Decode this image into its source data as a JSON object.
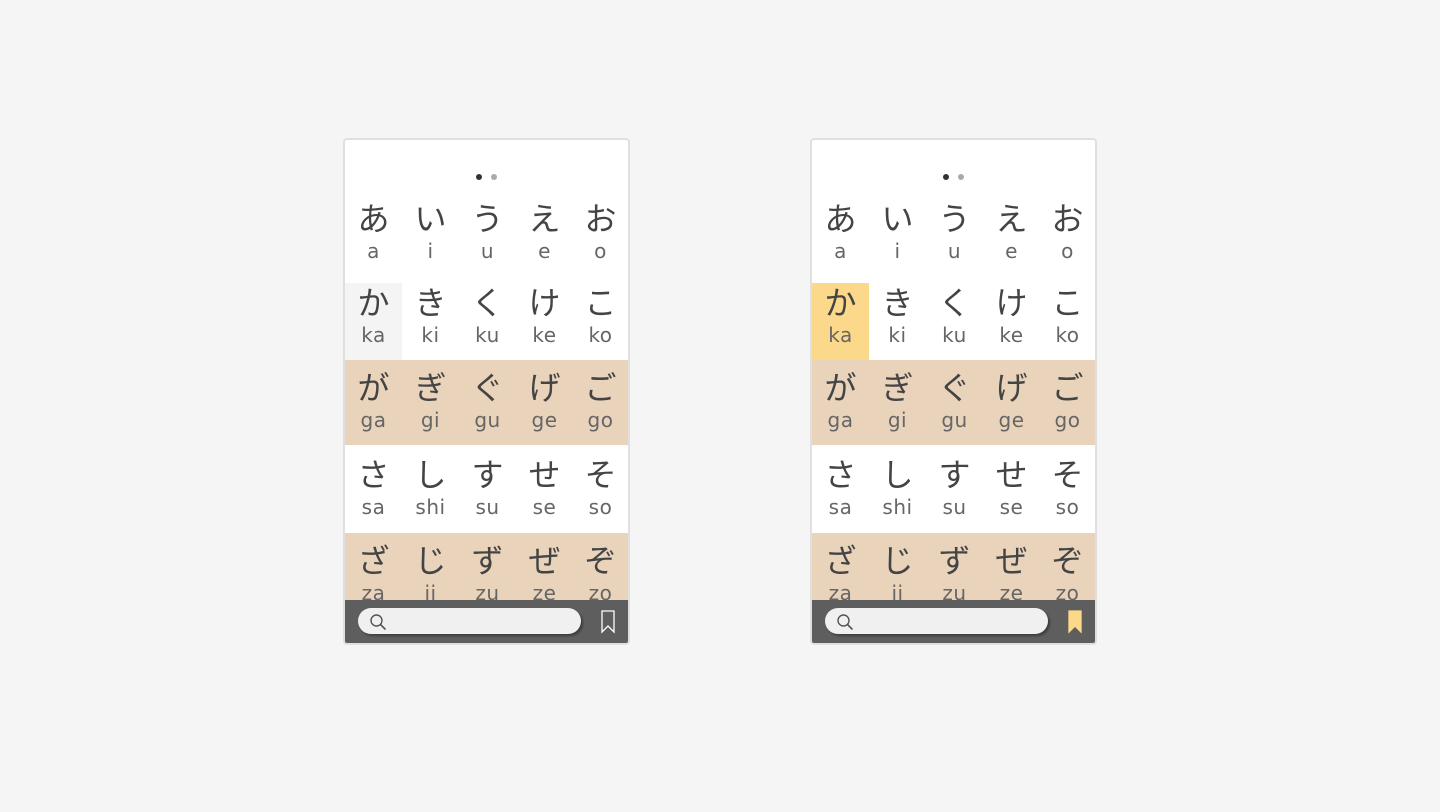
{
  "pager": {
    "pages": 2,
    "current": 1
  },
  "rows": [
    {
      "type": "plain",
      "cells": [
        {
          "kana": "あ",
          "romaji": "a"
        },
        {
          "kana": "い",
          "romaji": "i"
        },
        {
          "kana": "う",
          "romaji": "u"
        },
        {
          "kana": "え",
          "romaji": "e"
        },
        {
          "kana": "お",
          "romaji": "o"
        }
      ]
    },
    {
      "type": "plain",
      "cells": [
        {
          "kana": "か",
          "romaji": "ka"
        },
        {
          "kana": "き",
          "romaji": "ki"
        },
        {
          "kana": "く",
          "romaji": "ku"
        },
        {
          "kana": "け",
          "romaji": "ke"
        },
        {
          "kana": "こ",
          "romaji": "ko"
        }
      ]
    },
    {
      "type": "dakuten",
      "cells": [
        {
          "kana": "が",
          "romaji": "ga"
        },
        {
          "kana": "ぎ",
          "romaji": "gi"
        },
        {
          "kana": "ぐ",
          "romaji": "gu"
        },
        {
          "kana": "げ",
          "romaji": "ge"
        },
        {
          "kana": "ご",
          "romaji": "go"
        }
      ]
    },
    {
      "type": "plain",
      "cells": [
        {
          "kana": "さ",
          "romaji": "sa"
        },
        {
          "kana": "し",
          "romaji": "shi"
        },
        {
          "kana": "す",
          "romaji": "su"
        },
        {
          "kana": "せ",
          "romaji": "se"
        },
        {
          "kana": "そ",
          "romaji": "so"
        }
      ]
    },
    {
      "type": "dakuten",
      "cells": [
        {
          "kana": "ざ",
          "romaji": "za"
        },
        {
          "kana": "じ",
          "romaji": "ji"
        },
        {
          "kana": "ず",
          "romaji": "zu"
        },
        {
          "kana": "ぜ",
          "romaji": "ze"
        },
        {
          "kana": "ぞ",
          "romaji": "zo"
        }
      ]
    }
  ],
  "screens": [
    {
      "name": "hover-state",
      "highlight": "hover",
      "highlight_cell": "か",
      "bookmark_active": false
    },
    {
      "name": "selected-state",
      "highlight": "selected",
      "highlight_cell": "か",
      "bookmark_active": true
    }
  ],
  "search": {
    "placeholder": "",
    "icon": "search-icon"
  },
  "bookmark": {
    "icon": "bookmark-icon"
  },
  "colors": {
    "background": "#f5f5f5",
    "dakuten_row": "#e9d3bb",
    "selected": "#fcd98a",
    "hover": "#f4f4f4",
    "bottom_bar": "#5e5e5e",
    "bookmark_active": "#fcd98a",
    "bookmark_inactive": "#ffffff"
  }
}
